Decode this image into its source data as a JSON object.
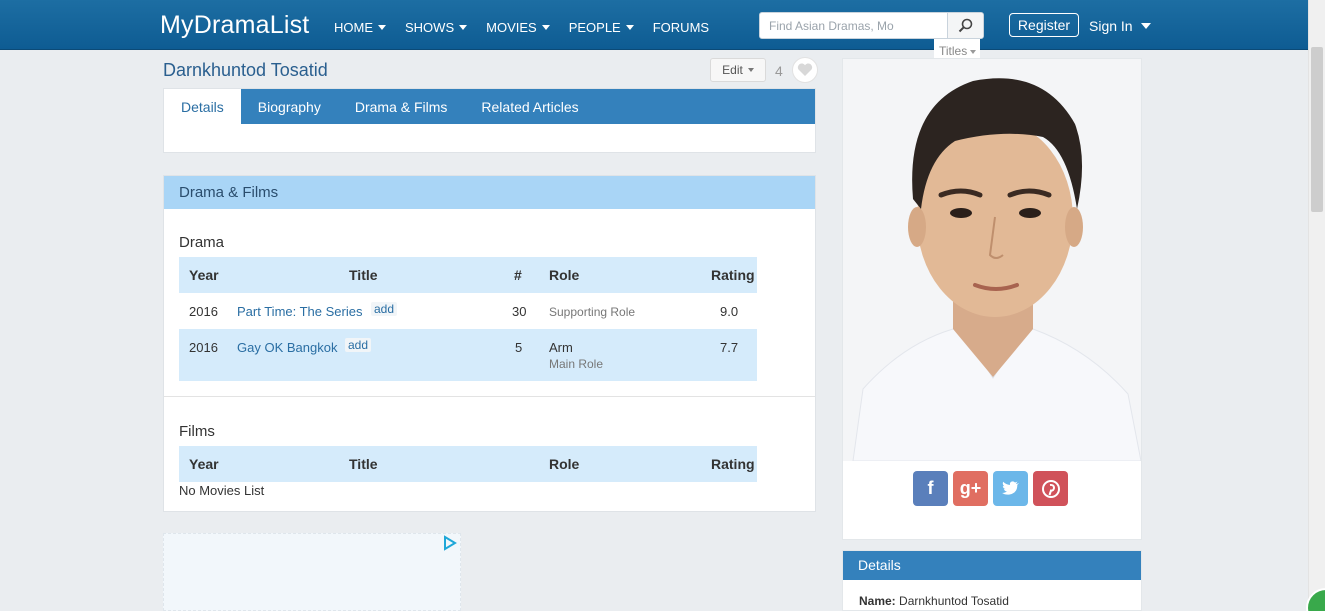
{
  "header": {
    "logo": "MyDramaList",
    "nav": [
      "HOME",
      "SHOWS",
      "MOVIES",
      "PEOPLE",
      "FORUMS"
    ],
    "search_placeholder": "Find Asian Dramas, Mo",
    "search_scope": "Titles",
    "register": "Register",
    "sign_in": "Sign In"
  },
  "person": {
    "name": "Darnkhuntod Tosatid",
    "edit_label": "Edit",
    "favorite_count": "4"
  },
  "tabs": [
    "Details",
    "Biography",
    "Drama & Films",
    "Related Articles"
  ],
  "films_card": {
    "title": "Drama & Films",
    "drama_heading": "Drama",
    "drama_columns": [
      "Year",
      "Title",
      "#",
      "Role",
      "Rating"
    ],
    "drama_rows": [
      {
        "year": "2016",
        "title": "Part Time: The Series",
        "add": "add",
        "episodes": "30",
        "role": "",
        "role_type": "Supporting Role",
        "rating": "9.0"
      },
      {
        "year": "2016",
        "title": "Gay OK Bangkok",
        "add": "add",
        "episodes": "5",
        "role": "Arm",
        "role_type": "Main Role",
        "rating": "7.7"
      }
    ],
    "films_heading": "Films",
    "films_columns": [
      "Year",
      "Title",
      "Role",
      "Rating"
    ],
    "no_movies": "No Movies List"
  },
  "social": [
    "facebook-icon",
    "google-plus-icon",
    "twitter-icon",
    "pinterest-icon"
  ],
  "details": {
    "title": "Details",
    "name_label": "Name:",
    "name_value": "Darnkhuntod Tosatid"
  },
  "colors": {
    "nav_bg": "#0e5c93",
    "tab_bg": "#3481bc",
    "card_head": "#a9d5f6",
    "row_alt": "#d5ebfb",
    "link": "#2a6ea3"
  }
}
